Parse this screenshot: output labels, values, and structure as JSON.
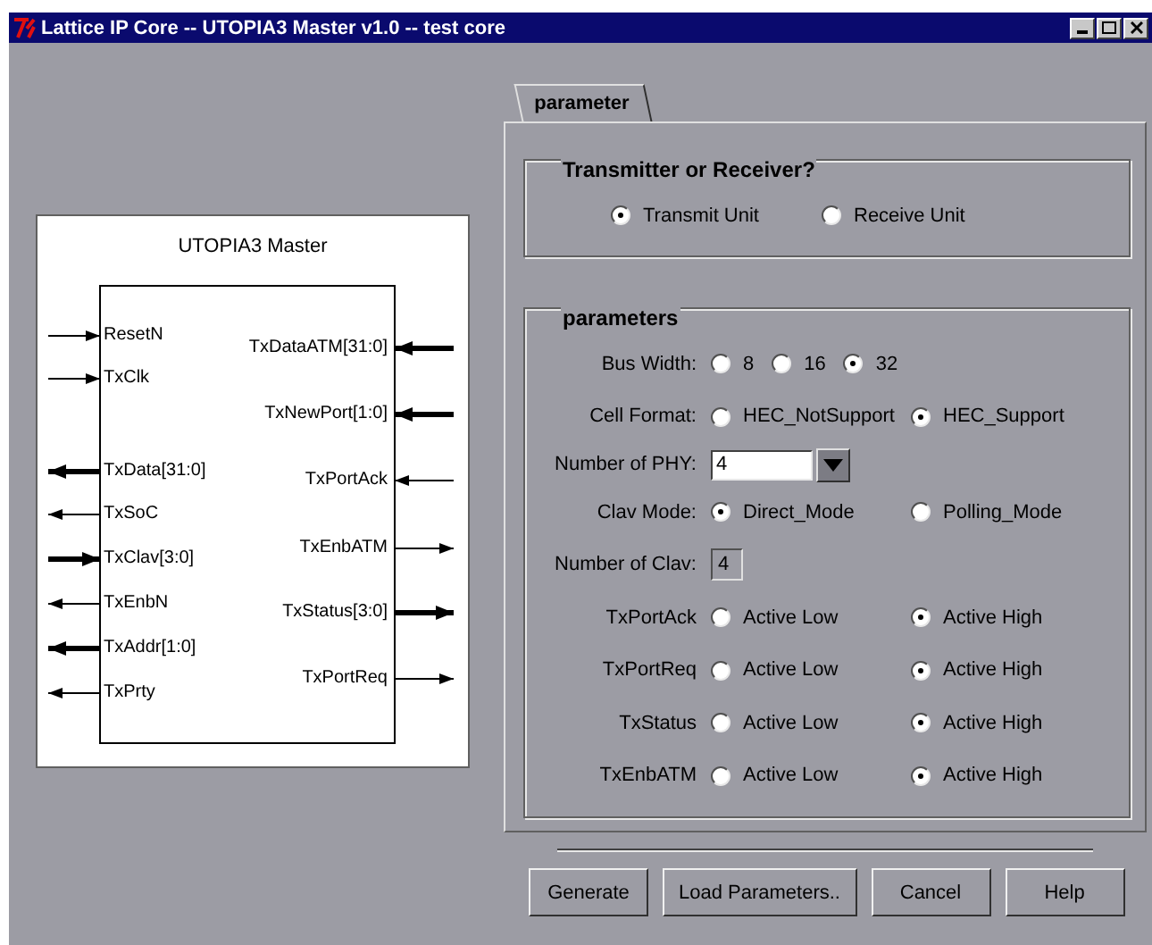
{
  "window": {
    "title": "Lattice IP Core -- UTOPIA3 Master v1.0 -- test core"
  },
  "diagram": {
    "title": "UTOPIA3 Master",
    "left_pins": [
      {
        "name": "ResetN",
        "input": true,
        "bus": false
      },
      {
        "name": "TxClk",
        "input": true,
        "bus": false
      },
      {
        "name": "TxData[31:0]",
        "input": false,
        "bus": true
      },
      {
        "name": "TxSoC",
        "input": false,
        "bus": false
      },
      {
        "name": "TxClav[3:0]",
        "input": true,
        "bus": true
      },
      {
        "name": "TxEnbN",
        "input": false,
        "bus": false
      },
      {
        "name": "TxAddr[1:0]",
        "input": false,
        "bus": true
      },
      {
        "name": "TxPrty",
        "input": false,
        "bus": false
      }
    ],
    "right_pins": [
      {
        "name": "TxDataATM[31:0]",
        "input": true,
        "bus": true
      },
      {
        "name": "TxNewPort[1:0]",
        "input": true,
        "bus": true
      },
      {
        "name": "TxPortAck",
        "input": true,
        "bus": false
      },
      {
        "name": "TxEnbATM",
        "input": false,
        "bus": false
      },
      {
        "name": "TxStatus[3:0]",
        "input": false,
        "bus": true
      },
      {
        "name": "TxPortReq",
        "input": false,
        "bus": false
      }
    ]
  },
  "tabs": [
    {
      "label": "parameter",
      "selected": true
    }
  ],
  "groups": [
    {
      "title": "Transmitter or Receiver?",
      "rows": [
        {
          "kind": "radio-wide",
          "options": [
            {
              "label": "Transmit Unit",
              "selected": true
            },
            {
              "label": "Receive Unit",
              "selected": false
            }
          ]
        }
      ]
    },
    {
      "title": "parameters",
      "rows": [
        {
          "kind": "radio-compact",
          "label": "Bus Width:",
          "options": [
            {
              "label": "8",
              "selected": false
            },
            {
              "label": "16",
              "selected": false
            },
            {
              "label": "32",
              "selected": true
            }
          ]
        },
        {
          "kind": "radio",
          "label": "Cell Format:",
          "options": [
            {
              "label": "HEC_NotSupport",
              "selected": false
            },
            {
              "label": "HEC_Support",
              "selected": true
            }
          ]
        },
        {
          "kind": "dropdown",
          "label": "Number of PHY:",
          "value": "4"
        },
        {
          "kind": "radio",
          "label": "Clav Mode:",
          "options": [
            {
              "label": "Direct_Mode",
              "selected": true
            },
            {
              "label": "Polling_Mode",
              "selected": false
            }
          ]
        },
        {
          "kind": "readonly",
          "label": "Number of Clav:",
          "value": "4"
        },
        {
          "kind": "radio",
          "label": "TxPortAck",
          "options": [
            {
              "label": "Active Low",
              "selected": false
            },
            {
              "label": "Active High",
              "selected": true
            }
          ]
        },
        {
          "kind": "radio",
          "label": "TxPortReq",
          "options": [
            {
              "label": "Active Low",
              "selected": false
            },
            {
              "label": "Active High",
              "selected": true
            }
          ]
        },
        {
          "kind": "radio",
          "label": "TxStatus",
          "options": [
            {
              "label": "Active Low",
              "selected": false
            },
            {
              "label": "Active High",
              "selected": true
            }
          ]
        },
        {
          "kind": "radio",
          "label": "TxEnbATM",
          "options": [
            {
              "label": "Active Low",
              "selected": false
            },
            {
              "label": "Active High",
              "selected": true
            }
          ]
        }
      ]
    }
  ],
  "buttons": [
    "Generate",
    "Load Parameters..",
    "Cancel",
    "Help"
  ]
}
